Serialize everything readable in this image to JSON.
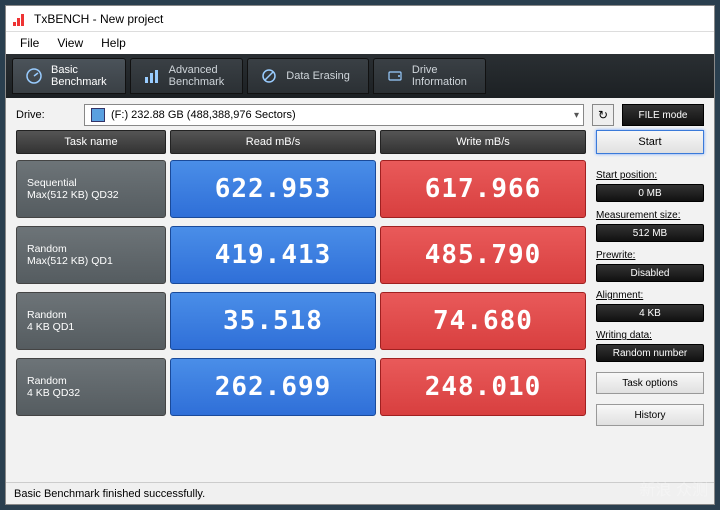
{
  "window": {
    "title": "TxBENCH - New project"
  },
  "menu": {
    "file": "File",
    "view": "View",
    "help": "Help"
  },
  "tabs": {
    "basic": {
      "line1": "Basic",
      "line2": "Benchmark"
    },
    "advanced": {
      "line1": "Advanced",
      "line2": "Benchmark"
    },
    "erasing": {
      "line1": "Data Erasing"
    },
    "info": {
      "line1": "Drive",
      "line2": "Information"
    }
  },
  "drive": {
    "label": "Drive:",
    "value": "(F:)   232.88 GB (488,388,976 Sectors)"
  },
  "filemode": "FILE mode",
  "table": {
    "headers": {
      "task": "Task name",
      "read": "Read mB/s",
      "write": "Write mB/s"
    },
    "rows": [
      {
        "name1": "Sequential",
        "name2": "Max(512 KB) QD32",
        "read": "622.953",
        "write": "617.966"
      },
      {
        "name1": "Random",
        "name2": "Max(512 KB) QD1",
        "read": "419.413",
        "write": "485.790"
      },
      {
        "name1": "Random",
        "name2": "4 KB QD1",
        "read": "35.518",
        "write": "74.680"
      },
      {
        "name1": "Random",
        "name2": "4 KB QD32",
        "read": "262.699",
        "write": "248.010"
      }
    ]
  },
  "side": {
    "start": "Start",
    "start_pos_label": "Start position:",
    "start_pos": "0 MB",
    "meas_label": "Measurement size:",
    "meas": "512 MB",
    "prewrite_label": "Prewrite:",
    "prewrite": "Disabled",
    "align_label": "Alignment:",
    "align": "4 KB",
    "wdata_label": "Writing data:",
    "wdata": "Random number",
    "task_options": "Task options",
    "history": "History"
  },
  "status": "Basic Benchmark finished successfully.",
  "watermark": "新浪 众测"
}
